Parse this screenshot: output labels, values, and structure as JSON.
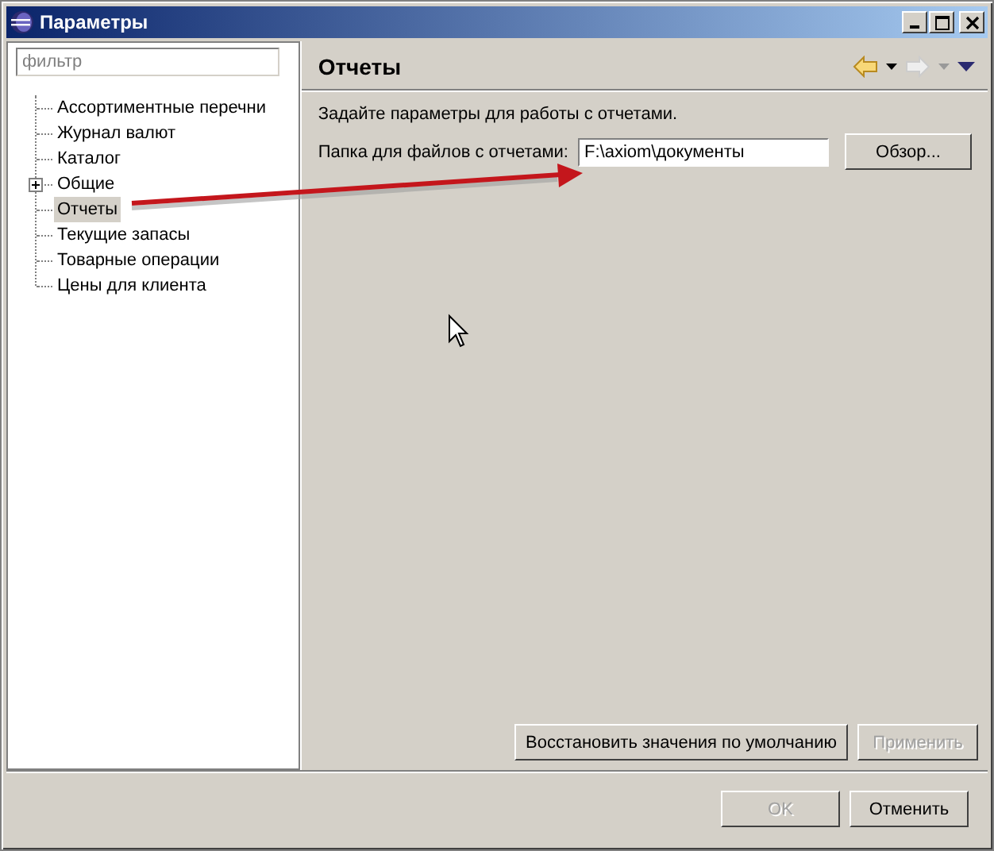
{
  "window": {
    "title": "Параметры"
  },
  "sidebar": {
    "filter": {
      "placeholder": "фильтр"
    },
    "items": [
      {
        "label": "Ассортиментные перечни",
        "kind": "leaf",
        "selected": false
      },
      {
        "label": "Журнал валют",
        "kind": "leaf",
        "selected": false
      },
      {
        "label": "Каталог",
        "kind": "leaf",
        "selected": false
      },
      {
        "label": "Общие",
        "kind": "folder",
        "expanded": false,
        "selected": false
      },
      {
        "label": "Отчеты",
        "kind": "leaf",
        "selected": true
      },
      {
        "label": "Текущие запасы",
        "kind": "leaf",
        "selected": false
      },
      {
        "label": "Товарные операции",
        "kind": "leaf",
        "selected": false
      },
      {
        "label": "Цены для клиента",
        "kind": "leaf",
        "selected": false
      }
    ]
  },
  "page": {
    "title": "Отчеты",
    "description": "Задайте параметры для работы с отчетами.",
    "folder_label": "Папка для файлов с отчетами:",
    "folder_value": "F:\\axiom\\документы",
    "browse_button": {
      "label": "Обзор..."
    },
    "restore_button": {
      "label": "Восстановить значения по умолчанию"
    },
    "apply_button": {
      "label": "Применить",
      "disabled": true
    }
  },
  "buttons": [
    {
      "label": "OK",
      "disabled": true
    },
    {
      "label": "Отменить",
      "disabled": false
    }
  ]
}
